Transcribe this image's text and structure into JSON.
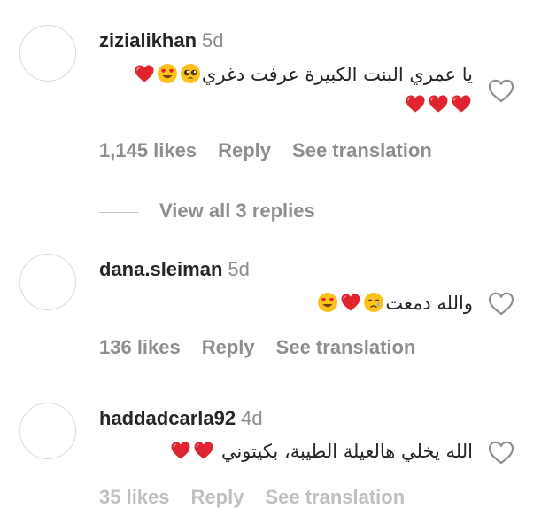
{
  "comments": [
    {
      "username": "zizialikhan",
      "age": "5d",
      "text": "يا عمري البنت الكبيرة عرفت دغري",
      "likes": "1,145 likes",
      "reply": "Reply",
      "translate": "See translation"
    },
    {
      "username": "dana.sleiman",
      "age": "5d",
      "text": "والله دمعت",
      "likes": "136 likes",
      "reply": "Reply",
      "translate": "See translation"
    },
    {
      "username": "haddadcarla92",
      "age": "4d",
      "text": "الله يخلي هالعيلة الطيبة، بكيتوني",
      "likes": "35 likes",
      "reply": "Reply",
      "translate": "See translation"
    }
  ],
  "view_replies": "View all 3 replies",
  "colors": {
    "text": "#262626",
    "muted": "#8e8e8e",
    "heart": "#e0242f",
    "face": "#fcc21b"
  },
  "icons": {
    "like": "heart-outline-icon",
    "red_heart": "red-heart-emoji",
    "heart_eyes": "heart-eyes-emoji",
    "pleading": "pleading-face-emoji",
    "crying": "crying-face-emoji"
  }
}
